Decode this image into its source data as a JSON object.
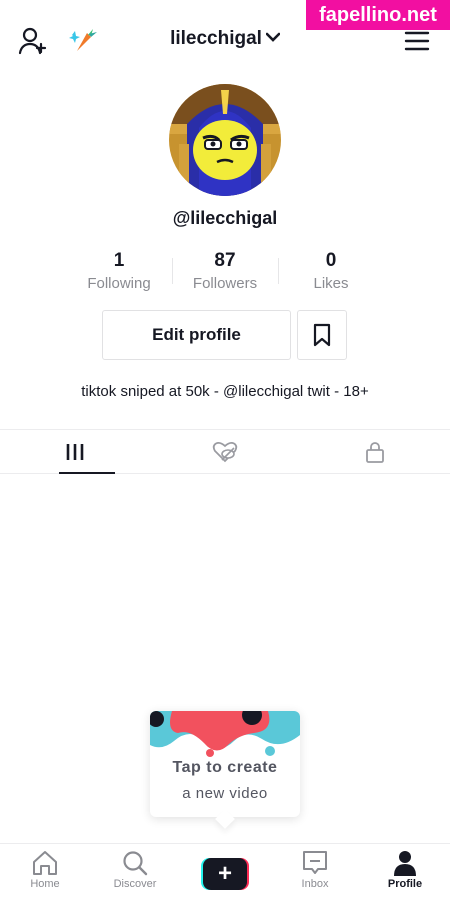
{
  "watermark": "fapellino.net",
  "header": {
    "username": "lilecchigal",
    "icons": [
      "add-user-icon",
      "carrot-icon",
      "menu-icon",
      "chevron-down-icon"
    ]
  },
  "profile": {
    "handle": "@lilecchigal",
    "stats": [
      {
        "value": "1",
        "label": "Following"
      },
      {
        "value": "87",
        "label": "Followers"
      },
      {
        "value": "0",
        "label": "Likes"
      }
    ],
    "edit_label": "Edit profile",
    "bio": "tiktok sniped at 50k - @lilecchigal twit - 18+"
  },
  "tabs": [
    "videos-grid-icon",
    "liked-hidden-icon",
    "lock-icon"
  ],
  "tooltip": {
    "line1": "Tap to create",
    "line2": "a new video"
  },
  "nav": [
    {
      "label": "Home",
      "icon": "home-icon"
    },
    {
      "label": "Discover",
      "icon": "search-icon"
    },
    {
      "label": "",
      "icon": "create-plus-icon"
    },
    {
      "label": "Inbox",
      "icon": "inbox-icon"
    },
    {
      "label": "Profile",
      "icon": "profile-icon"
    }
  ],
  "colors": {
    "text": "#161823",
    "muted": "#8a8b91",
    "accent_pink": "#fe2c55",
    "accent_cyan": "#25f4ee",
    "watermark_bg": "#f20fa1"
  }
}
